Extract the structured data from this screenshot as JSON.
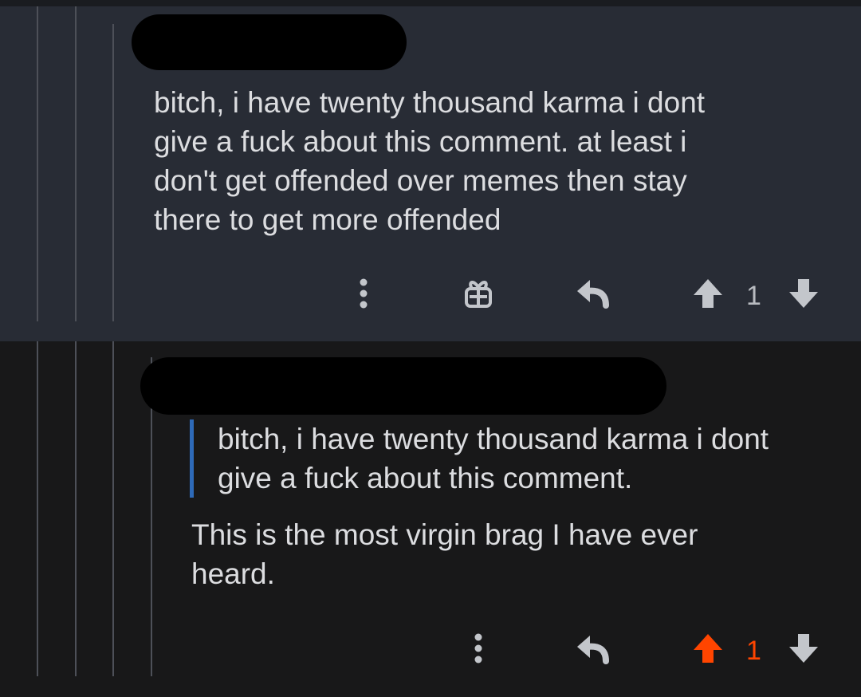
{
  "comments": [
    {
      "body": "bitch, i have twenty thousand karma i dont\ngive a fuck about this comment. at least i\ndon't get offended over memes then stay\nthere to get more offended",
      "score": "1",
      "upvoted": false
    },
    {
      "quote": "bitch, i have twenty thousand karma i dont\ngive a fuck about this comment.",
      "body": "This is the most virgin brag I have ever\nheard.",
      "score": "1",
      "upvoted": true
    }
  ],
  "colors": {
    "upvote_active": "#ff4500",
    "quote_bar": "#2e6ab8",
    "icon_default": "#c3c6cb"
  },
  "icons": [
    "more-options-icon",
    "gift-icon",
    "reply-icon",
    "upvote-icon",
    "downvote-icon"
  ]
}
